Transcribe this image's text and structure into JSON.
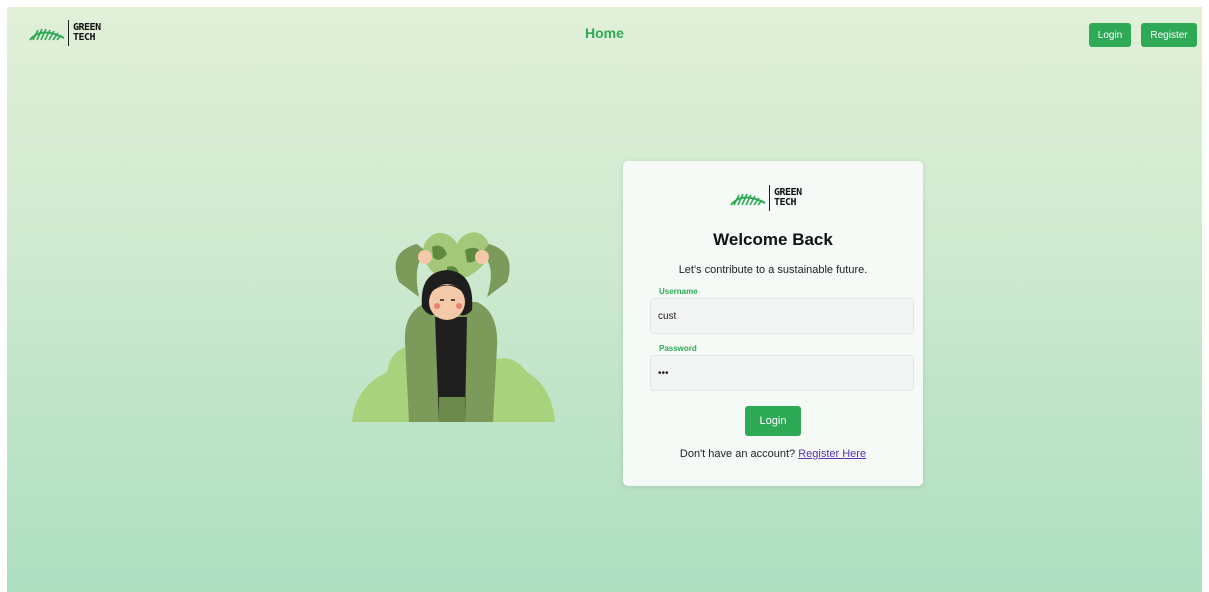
{
  "header": {
    "logo_line1": "GREEN",
    "logo_line2": "TECH",
    "nav_home": "Home",
    "login_label": "Login",
    "register_label": "Register"
  },
  "card": {
    "logo_line1": "GREEN",
    "logo_line2": "TECH",
    "title": "Welcome Back",
    "subtitle": "Let's contribute to a sustainable future.",
    "username_label": "Username",
    "username_value": "cust",
    "password_label": "Password",
    "password_value": "•••",
    "login_button": "Login",
    "footer_text": "Don't have an account?",
    "footer_link": "Register Here"
  },
  "colors": {
    "accent": "#2ea956",
    "link": "#5a2fb0",
    "background_top": "#e2f0d8",
    "background_bottom": "#addec0"
  },
  "icons": {
    "logo": "green-tech-hill-logo-icon",
    "illustration": "woman-holding-globe-illustration",
    "annotation": "arrow-right-icon"
  }
}
